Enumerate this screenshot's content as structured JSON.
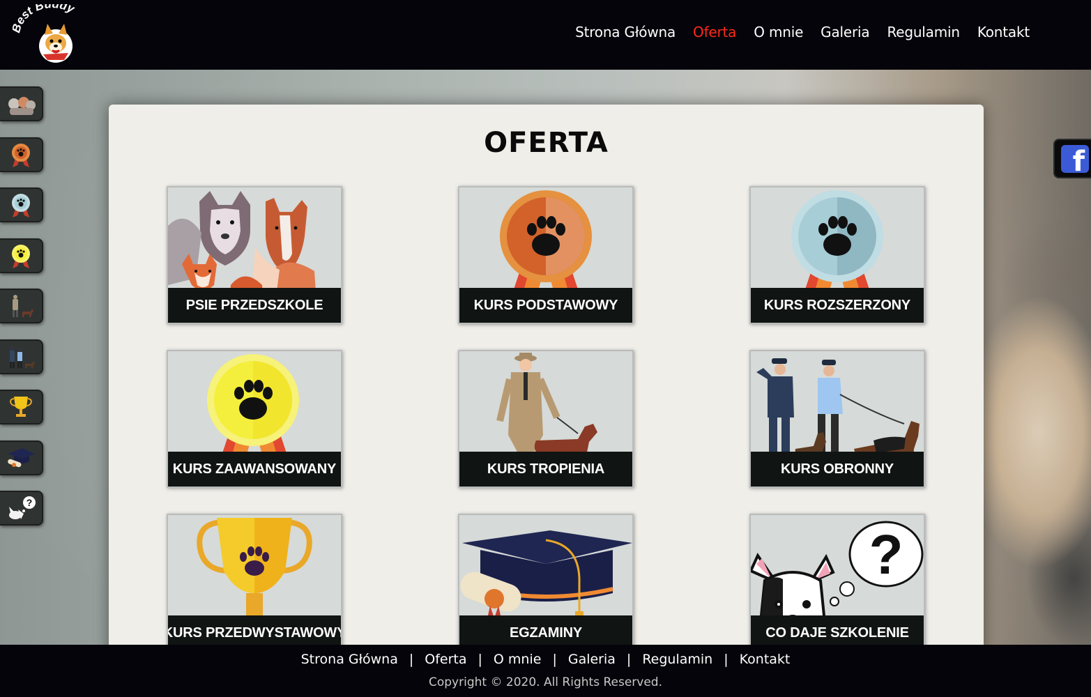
{
  "header": {
    "logo_text": "Best Buddy",
    "nav": [
      {
        "label": "Strona Główna",
        "active": false
      },
      {
        "label": "Oferta",
        "active": true
      },
      {
        "label": "O mnie",
        "active": false
      },
      {
        "label": "Galeria",
        "active": false
      },
      {
        "label": "Regulamin",
        "active": false
      },
      {
        "label": "Kontakt",
        "active": false
      }
    ]
  },
  "sidebar": {
    "items": [
      {
        "icon": "puppies-icon"
      },
      {
        "icon": "badge-basic-icon"
      },
      {
        "icon": "badge-extended-icon"
      },
      {
        "icon": "badge-advanced-icon"
      },
      {
        "icon": "tracking-icon"
      },
      {
        "icon": "defense-icon"
      },
      {
        "icon": "trophy-icon"
      },
      {
        "icon": "graduation-cap-icon"
      },
      {
        "icon": "question-dog-icon"
      }
    ]
  },
  "social": {
    "facebook_icon": "facebook-icon",
    "facebook_letter": "f"
  },
  "main": {
    "title": "OFERTA",
    "cards": [
      {
        "label": "PSIE PRZEDSZKOLE",
        "icon": "puppies-icon"
      },
      {
        "label": "KURS PODSTAWOWY",
        "icon": "badge-basic-icon"
      },
      {
        "label": "KURS ROZSZERZONY",
        "icon": "badge-extended-icon"
      },
      {
        "label": "KURS ZAAWANSOWANY",
        "icon": "badge-advanced-icon"
      },
      {
        "label": "KURS TROPIENIA",
        "icon": "tracking-icon"
      },
      {
        "label": "KURS OBRONNY",
        "icon": "defense-icon"
      },
      {
        "label": "KURS PRZEDWYSTAWOWY",
        "icon": "trophy-icon"
      },
      {
        "label": "EGZAMINY",
        "icon": "graduation-cap-icon"
      },
      {
        "label": "CO DAJE SZKOLENIE",
        "icon": "question-dog-icon"
      }
    ]
  },
  "footer": {
    "nav": [
      "Strona Główna",
      "Oferta",
      "O mnie",
      "Galeria",
      "Regulamin",
      "Kontakt"
    ],
    "separator": "|",
    "copyright": "Copyright © 2020. All Rights Reserved."
  },
  "colors": {
    "header_bg": "#04040a",
    "active_link": "#ff2a1a",
    "panel_bg": "#efeee9",
    "card_label_bg": "#101413",
    "badge_orange": "#d2622a",
    "badge_blue": "#a7cdd6",
    "badge_yellow": "#f4ef3c",
    "facebook_blue": "#3b5bd6"
  }
}
